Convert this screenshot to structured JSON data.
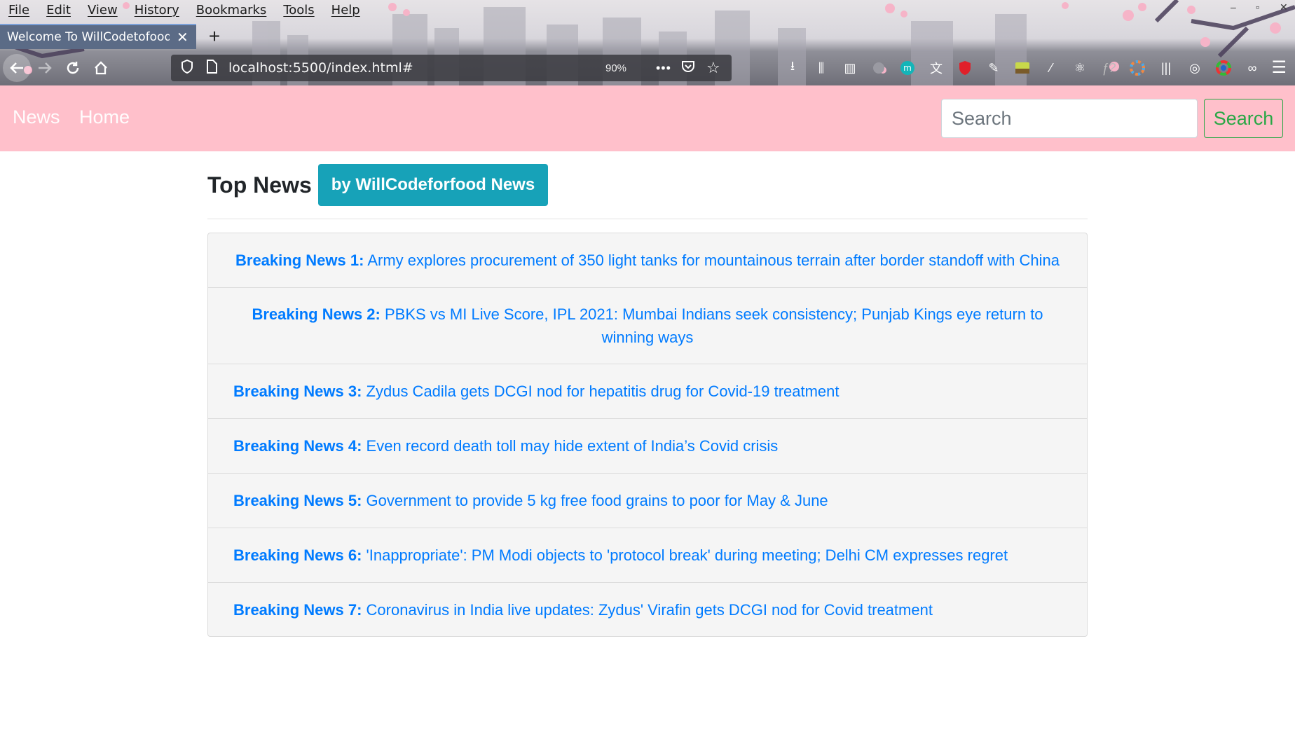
{
  "browser": {
    "menu": [
      "File",
      "Edit",
      "View",
      "History",
      "Bookmarks",
      "Tools",
      "Help"
    ],
    "tab_title": "Welcome To WillCodetofood",
    "url": "localhost:5500/index.html#",
    "zoom": "90%"
  },
  "navbar": {
    "brand": "News",
    "links": [
      "Home"
    ],
    "search_placeholder": "Search",
    "search_button": "Search"
  },
  "main": {
    "title": "Top News",
    "badge": "by WillCodeforfood News",
    "news": [
      {
        "label": "Breaking News 1:",
        "text": "Army explores procurement of 350 light tanks for mountainous terrain after border standoff with China"
      },
      {
        "label": "Breaking News 2:",
        "text": "PBKS vs MI Live Score, IPL 2021: Mumbai Indians seek consistency; Punjab Kings eye return to winning ways"
      },
      {
        "label": "Breaking News 3:",
        "text": "Zydus Cadila gets DCGI nod for hepatitis drug for Covid-19 treatment"
      },
      {
        "label": "Breaking News 4:",
        "text": "Even record death toll may hide extent of India’s Covid crisis"
      },
      {
        "label": "Breaking News 5:",
        "text": "Government to provide 5 kg free food grains to poor for May & June"
      },
      {
        "label": "Breaking News 6:",
        "text": "'Inappropriate': PM Modi objects to 'protocol break' during meeting; Delhi CM expresses regret"
      },
      {
        "label": "Breaking News 7:",
        "text": "Coronavirus in India live updates: Zydus' Virafin gets DCGI nod for Covid treatment"
      }
    ]
  },
  "colors": {
    "navbar_bg": "#ffc0cb",
    "badge_bg": "#17a2b8",
    "link": "#007bff",
    "search_btn": "#28a745"
  }
}
